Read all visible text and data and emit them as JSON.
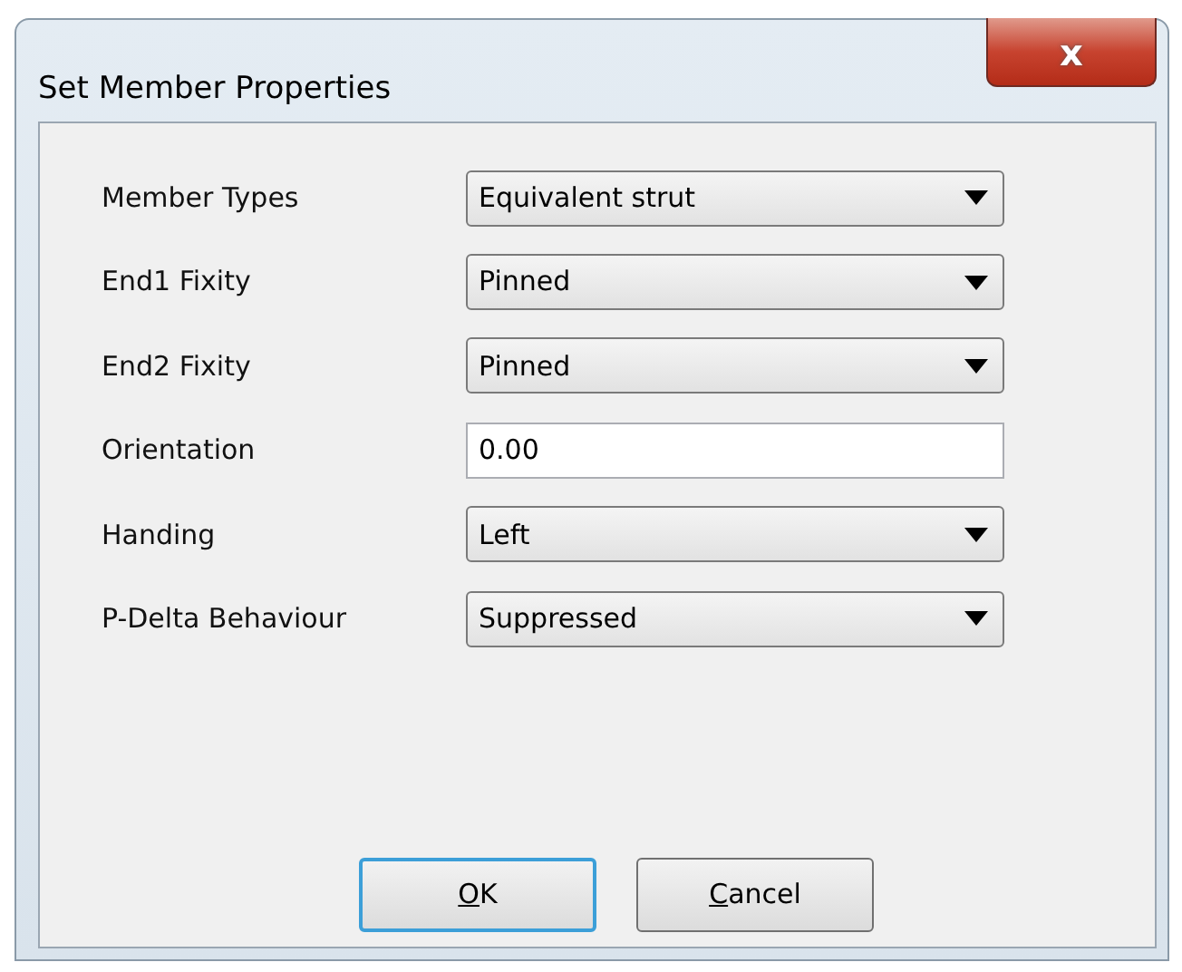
{
  "window": {
    "title": "Set Member Properties",
    "close_glyph": "x"
  },
  "fields": [
    {
      "label": "Member Types",
      "kind": "dropdown",
      "value": "Equivalent strut"
    },
    {
      "label": "End1 Fixity",
      "kind": "dropdown",
      "value": "Pinned"
    },
    {
      "label": "End2 Fixity",
      "kind": "dropdown",
      "value": "Pinned"
    },
    {
      "label": "Orientation",
      "kind": "text",
      "value": "0.00"
    },
    {
      "label": "Handing",
      "kind": "dropdown",
      "value": "Left"
    },
    {
      "label": "P-Delta Behaviour",
      "kind": "dropdown",
      "value": "Suppressed"
    }
  ],
  "buttons": [
    {
      "mnemonic": "O",
      "rest": "K",
      "default": true
    },
    {
      "mnemonic": "C",
      "rest": "ancel",
      "default": false
    }
  ]
}
